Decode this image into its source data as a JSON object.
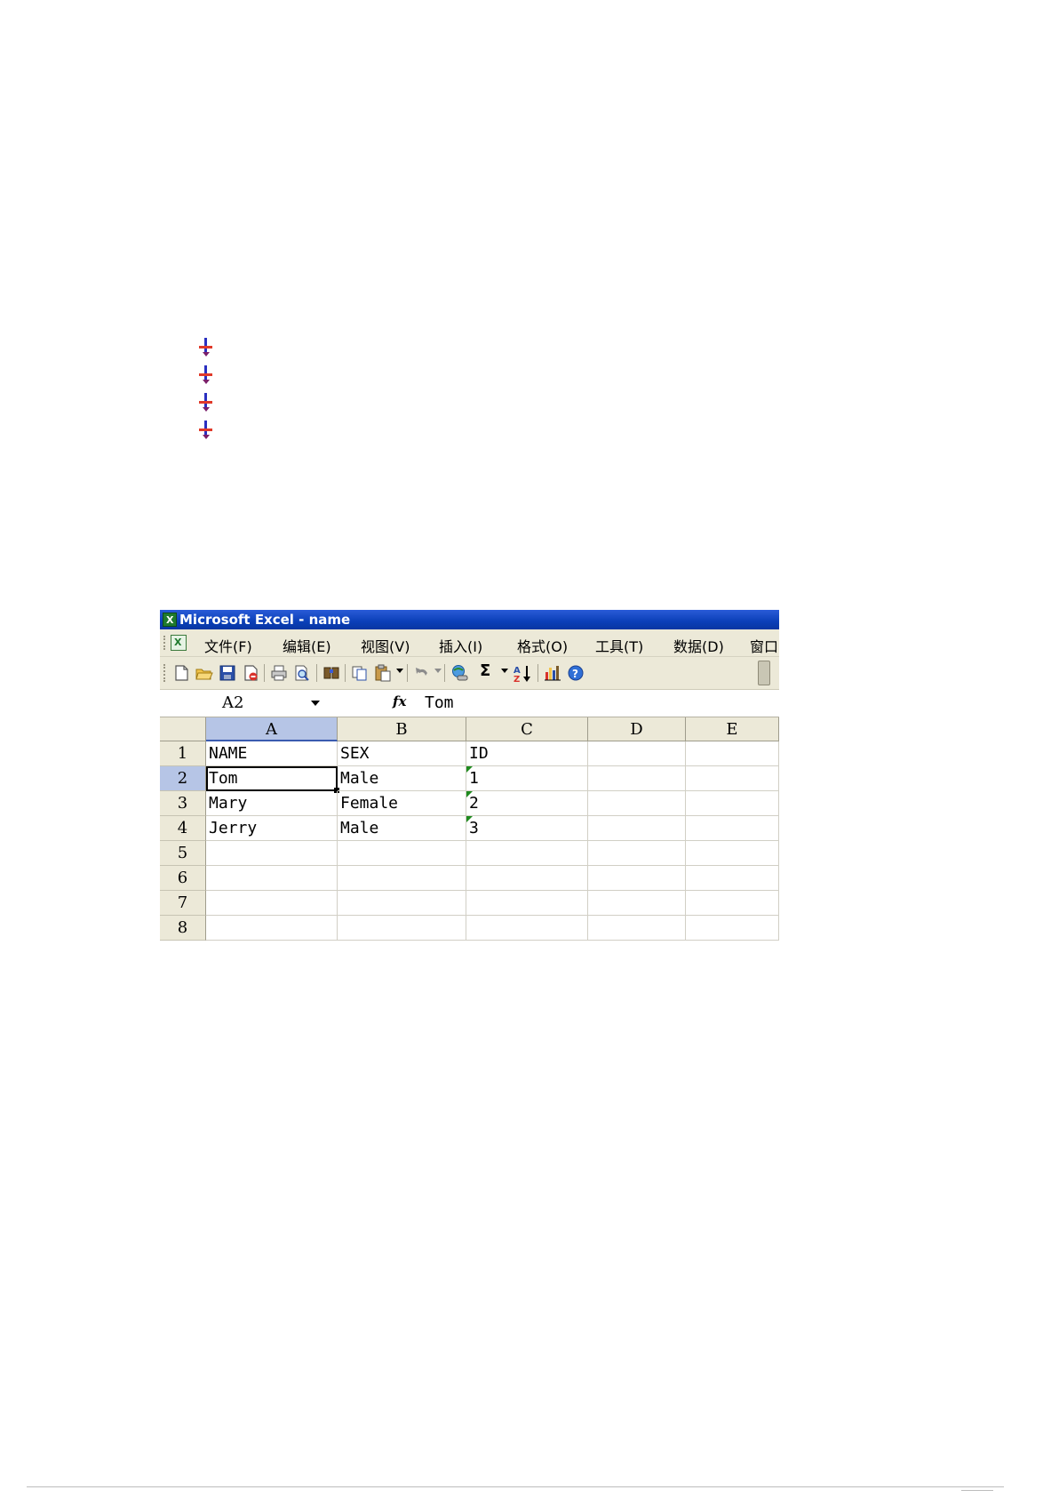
{
  "window": {
    "title": "Microsoft Excel - name"
  },
  "menu": {
    "items": [
      "文件(F)",
      "编辑(E)",
      "视图(V)",
      "插入(I)",
      "格式(O)",
      "工具(T)",
      "数据(D)",
      "窗口"
    ]
  },
  "toolbar": {
    "sum_symbol": "Σ",
    "sort_symbol": "A↓Z"
  },
  "formula_bar": {
    "name_box": "A2",
    "fx_label": "fx",
    "formula": "Tom"
  },
  "sheet": {
    "columns": [
      "A",
      "B",
      "C",
      "D",
      "E"
    ],
    "rows": [
      "1",
      "2",
      "3",
      "4",
      "5",
      "6",
      "7",
      "8"
    ],
    "cells": [
      [
        "NAME",
        "SEX",
        "ID",
        "",
        ""
      ],
      [
        "Tom",
        "Male",
        "1",
        "",
        ""
      ],
      [
        "Mary",
        "Female",
        "2",
        "",
        ""
      ],
      [
        "Jerry",
        "Male",
        "3",
        "",
        ""
      ],
      [
        "",
        "",
        "",
        "",
        ""
      ],
      [
        "",
        "",
        "",
        "",
        ""
      ],
      [
        "",
        "",
        "",
        "",
        ""
      ],
      [
        "",
        "",
        "",
        "",
        ""
      ]
    ],
    "active_cell": "A2"
  },
  "colors": {
    "titlebar": "#0a3fb8",
    "chrome": "#ece9d8",
    "selected_header": "#b6c5e6",
    "error_indicator": "#1e8a1e",
    "bullet_vertical": "#2a2fc0",
    "bullet_horizontal": "#e03a2a"
  }
}
